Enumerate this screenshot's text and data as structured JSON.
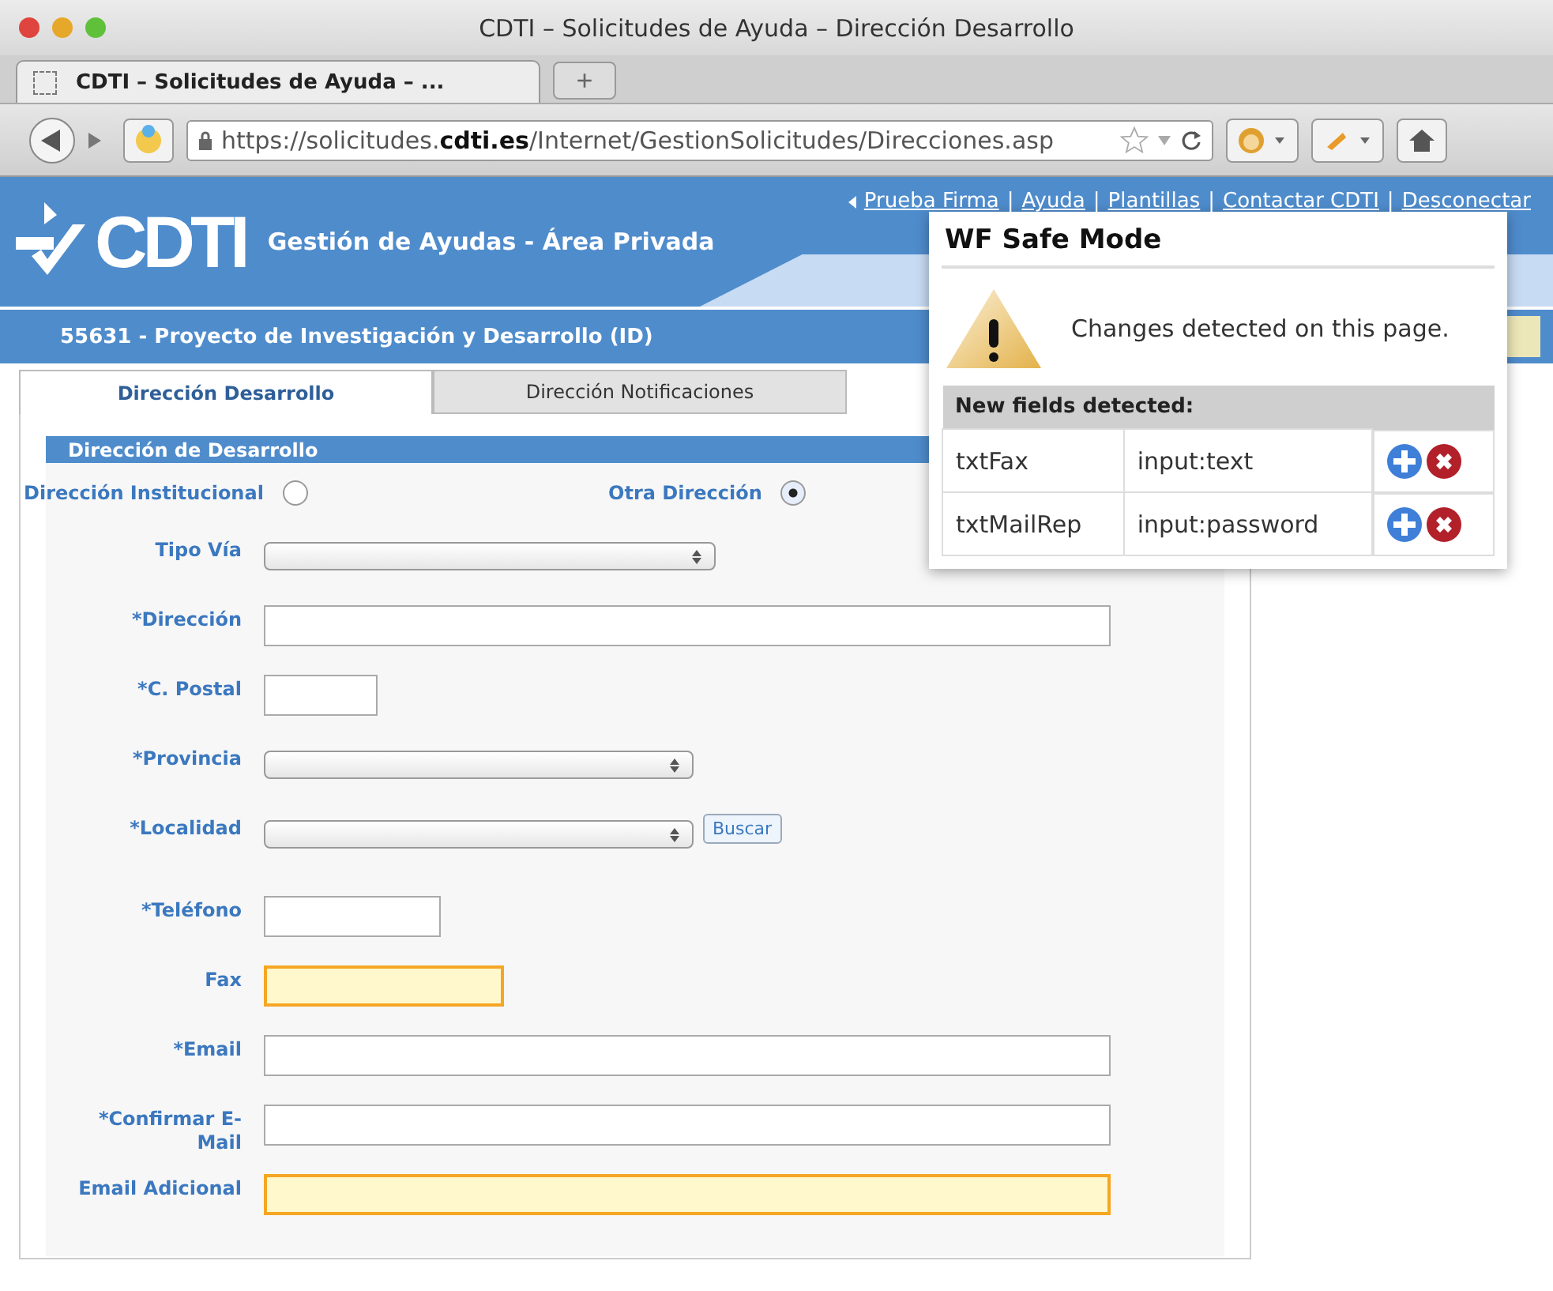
{
  "window": {
    "title": "CDTI – Solicitudes de Ayuda – Dirección Desarrollo"
  },
  "browser": {
    "tabs": [
      {
        "label": "CDTI – Solicitudes de Ayuda – ...",
        "selected": true
      }
    ],
    "new_tab": "+",
    "url": "https://solicitudes.**cdti.es**/Internet/GestionSolicitudes/Direcciones.asp"
  },
  "page": {
    "logo": "CDTI",
    "header_title": "Gestión de Ayudas - Área Privada",
    "top_links": [
      "Prueba Firma",
      "Ayuda",
      "Plantillas",
      "Contactar CDTI",
      "Desconectar"
    ],
    "link_separators": [
      "|",
      "|",
      "|",
      "|"
    ],
    "project_title": "55631 - Proyecto de Investigación y Desarrollo (ID)",
    "tabs": [
      {
        "label": "Dirección Desarrollo",
        "selected": true
      },
      {
        "label": "Dirección Notificaciones",
        "selected": false
      }
    ],
    "section_title": "Dirección de Desarrollo",
    "address_options": [
      {
        "label": "Dirección Institucional",
        "selected": false
      },
      {
        "label": "Otra Dirección",
        "selected": true
      }
    ],
    "fields": [
      {
        "label": "Tipo Vía",
        "kind": "select"
      },
      {
        "label": "*Dirección",
        "kind": "text",
        "highlighted": false
      },
      {
        "label": "*C. Postal",
        "kind": "text",
        "highlighted": false
      },
      {
        "label": "*Provincia",
        "kind": "select"
      },
      {
        "label": "*Localidad",
        "kind": "select",
        "button": "Buscar"
      },
      {
        "label": "*Teléfono",
        "kind": "text",
        "highlighted": false
      },
      {
        "label": "Fax",
        "kind": "text",
        "highlighted": true
      },
      {
        "label": "*Email",
        "kind": "text",
        "highlighted": false
      },
      {
        "label": "*Confirmar E-Mail",
        "kind": "text",
        "highlighted": false
      },
      {
        "label": "Email Adicional",
        "kind": "text",
        "highlighted": true
      }
    ]
  },
  "popup": {
    "title": "WF Safe Mode",
    "message": "Changes detected on this page.",
    "table_heading": "New fields detected:",
    "rows": [
      {
        "name": "txtFax",
        "type": "input:text"
      },
      {
        "name": "txtMailRep",
        "type": "input:password"
      }
    ]
  }
}
